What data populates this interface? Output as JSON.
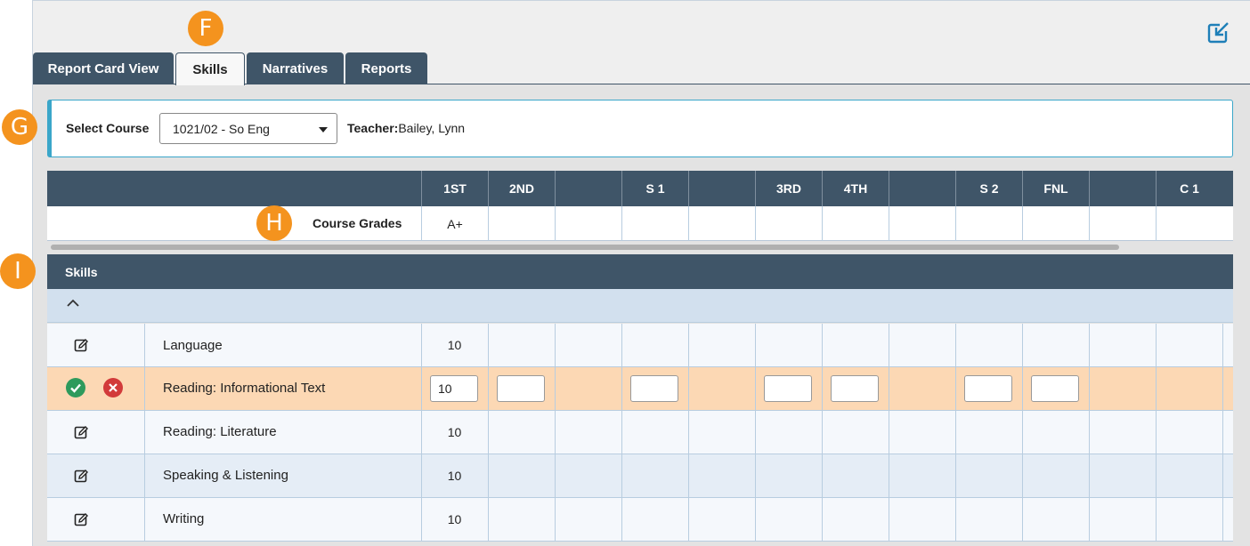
{
  "tabs": [
    {
      "label": "Report Card View"
    },
    {
      "label": "Skills"
    },
    {
      "label": "Narratives"
    },
    {
      "label": "Reports"
    }
  ],
  "callouts": {
    "f": "F",
    "g": "G",
    "h": "H",
    "i": "I"
  },
  "course": {
    "label": "Select Course",
    "selected": "1021/02 - So Eng",
    "teacher_label": "Teacher:",
    "teacher_name": "Bailey, Lynn"
  },
  "grid": {
    "columns": [
      "1ST",
      "2ND",
      "",
      "S 1",
      "",
      "3RD",
      "4TH",
      "",
      "S 2",
      "FNL",
      "",
      "C 1"
    ],
    "course_grades_label": "Course Grades",
    "course_grades": [
      "A+",
      "",
      "",
      "",
      "",
      "",
      "",
      "",
      "",
      "",
      "",
      ""
    ]
  },
  "skills": {
    "title": "Skills",
    "rows": [
      {
        "name": "Language",
        "first": "10"
      },
      {
        "name": "Reading: Informational Text",
        "first": "10"
      },
      {
        "name": "Reading: Literature",
        "first": "10"
      },
      {
        "name": "Speaking & Listening",
        "first": "10"
      },
      {
        "name": "Writing",
        "first": "10"
      }
    ]
  },
  "colors": {
    "header": "#3f5568",
    "callout": "#f4931e",
    "edit_row": "#fcd8b4",
    "accent": "#3aa6c9"
  }
}
